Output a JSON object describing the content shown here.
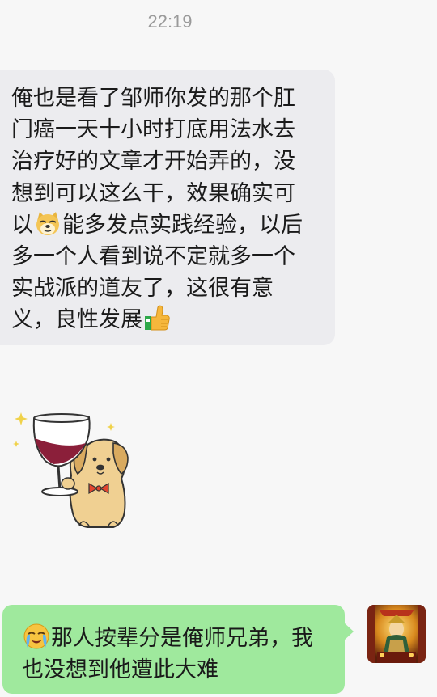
{
  "status": {
    "time": "22:19"
  },
  "messages": [
    {
      "direction": "incoming",
      "segments": [
        "俺也是看了邹师你发的那个肛门癌一天十小时打底用法水去治疗好的文章才开始弄的，没想到可以这么干，效果确实可以",
        "能多发点实践经验，以后多一个人看到说不定就多一个实战派的道友了，这很有意义，良性发展"
      ],
      "emojis": [
        "doge-emoji",
        "thumbs-up-emoji"
      ]
    },
    {
      "direction": "incoming",
      "type": "sticker",
      "sticker": "dog-with-wine-glass-sticker"
    },
    {
      "direction": "outgoing",
      "emoji": "loudly-crying-emoji",
      "text": "那人按辈分是俺师兄弟，我也没想到他遭此大难",
      "avatar": "temple-deity-avatar"
    }
  ],
  "colors": {
    "background": "#f7f7f7",
    "incoming_bubble": "#ececef",
    "outgoing_bubble": "#9fe99d",
    "timestamp": "#9a9a9a"
  }
}
